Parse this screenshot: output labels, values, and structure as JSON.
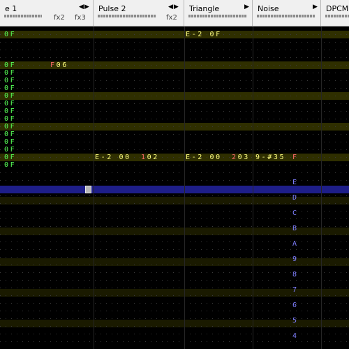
{
  "channels": [
    {
      "name": "e 1",
      "fx": [
        "fx2",
        "fx3"
      ],
      "has_arrows": true
    },
    {
      "name": "Pulse 2",
      "fx": [
        "fx2"
      ],
      "has_arrows": true
    },
    {
      "name": "Triangle",
      "fx": [],
      "has_arrows": true
    },
    {
      "name": "Noise",
      "fx": [],
      "has_arrows": true
    },
    {
      "name": "DPCM",
      "fx": [],
      "has_arrows": false
    }
  ],
  "arrows": "◀▶",
  "rows": [
    {
      "c1": "0F",
      "c3": "E-2 0F"
    },
    {},
    {},
    {},
    {
      "c1": "0F",
      "c1fx": "F06"
    },
    {
      "c1": "0F"
    },
    {
      "c1": "0F"
    },
    {
      "c1": "0F"
    },
    {
      "c1": "0F"
    },
    {
      "c1": "0F"
    },
    {
      "c1": "0F"
    },
    {
      "c1": "0F"
    },
    {
      "c1": "0F"
    },
    {
      "c1": "0F"
    },
    {
      "c1": "0F"
    },
    {
      "c1": "0F"
    },
    {
      "c1": "0F",
      "c2": "E-2 00",
      "c2fx": "102",
      "c3": "E-2 00",
      "c3fx": "203",
      "c4": "9-#35",
      "c4fx": "F"
    },
    {
      "c1": "0F"
    }
  ],
  "noise_column": [
    "E",
    "D",
    "C",
    "B",
    "A",
    "9",
    "8",
    "7",
    "6",
    "5",
    "4"
  ],
  "colors": {
    "volume": "#55ff55",
    "note": "#ffff80",
    "effect_cmd": "#ff6a6a",
    "effect_val": "#ffff80",
    "noise_col": "#8080ff",
    "cursor": "#1e1e88",
    "highlight_row": "#2f2f00"
  }
}
